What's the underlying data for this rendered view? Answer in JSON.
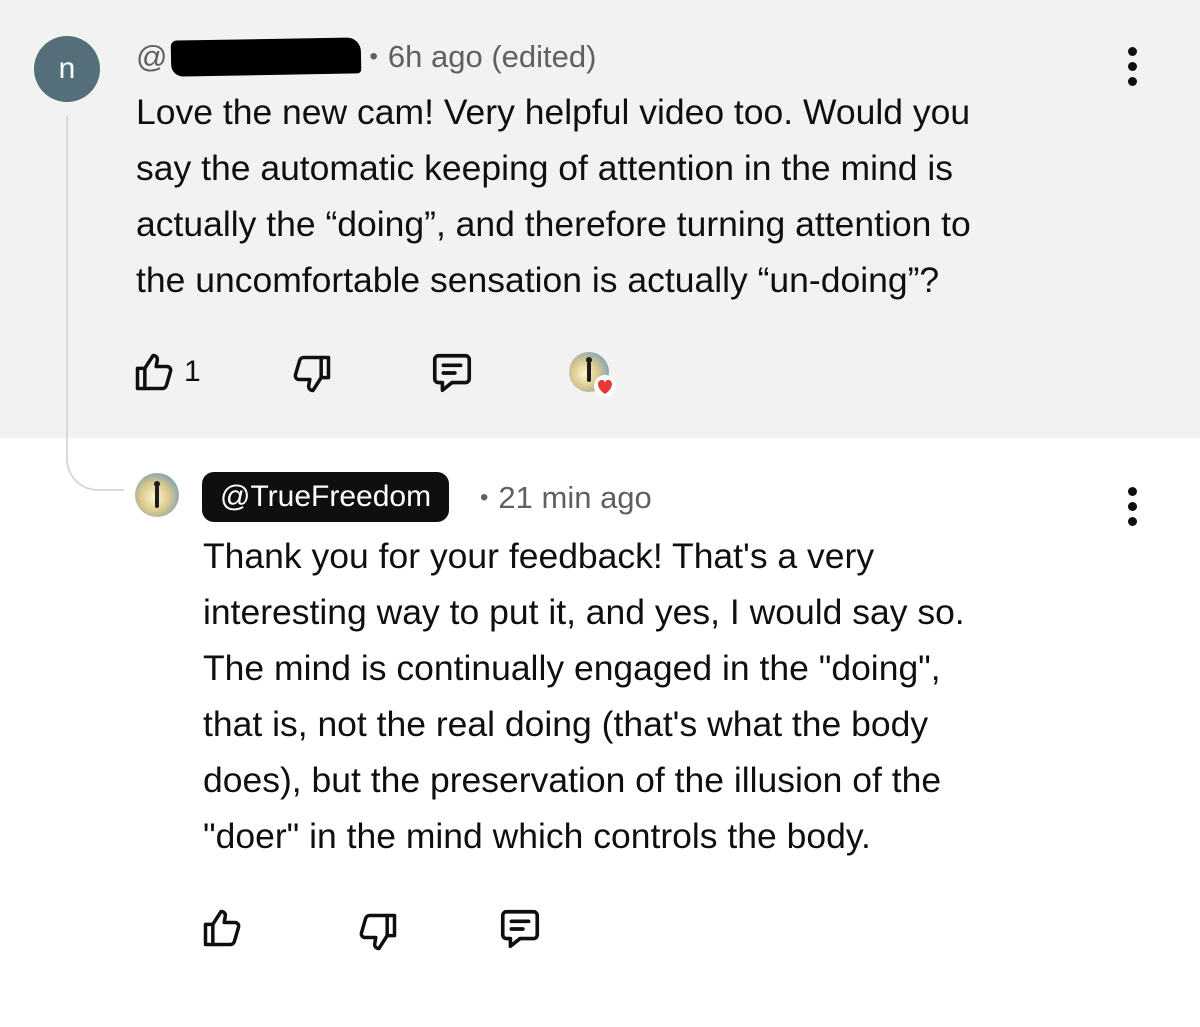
{
  "comment": {
    "avatar_letter": "n",
    "handle_prefix": "@",
    "timestamp": "6h ago (edited)",
    "text": "Love the new cam! Very helpful video too. Would you\nsay the automatic keeping of attention in the mind is\nactually the “doing”, and therefore turning attention to\nthe uncomfortable sensation is actually “un-doing”?",
    "like_count": "1"
  },
  "reply": {
    "author": "@TrueFreedom",
    "timestamp": "21 min ago",
    "text": "Thank you for your feedback! That's a very\ninteresting way to put it, and yes, I would say so.\nThe mind is continually engaged in the \"doing\",\nthat is, not the real doing (that's what the body\ndoes), but the preservation of the illusion of the\n\"doer\" in the mind which controls the body."
  },
  "colors": {
    "comment_background": "#f2f2f2",
    "avatar_background": "#546e7a",
    "heart": "#e53935",
    "badge_background": "#0f0f0f"
  },
  "icons": [
    "thumbs-up-icon",
    "thumbs-down-icon",
    "reply-comment-icon",
    "more-vert-icon",
    "heart-icon"
  ]
}
